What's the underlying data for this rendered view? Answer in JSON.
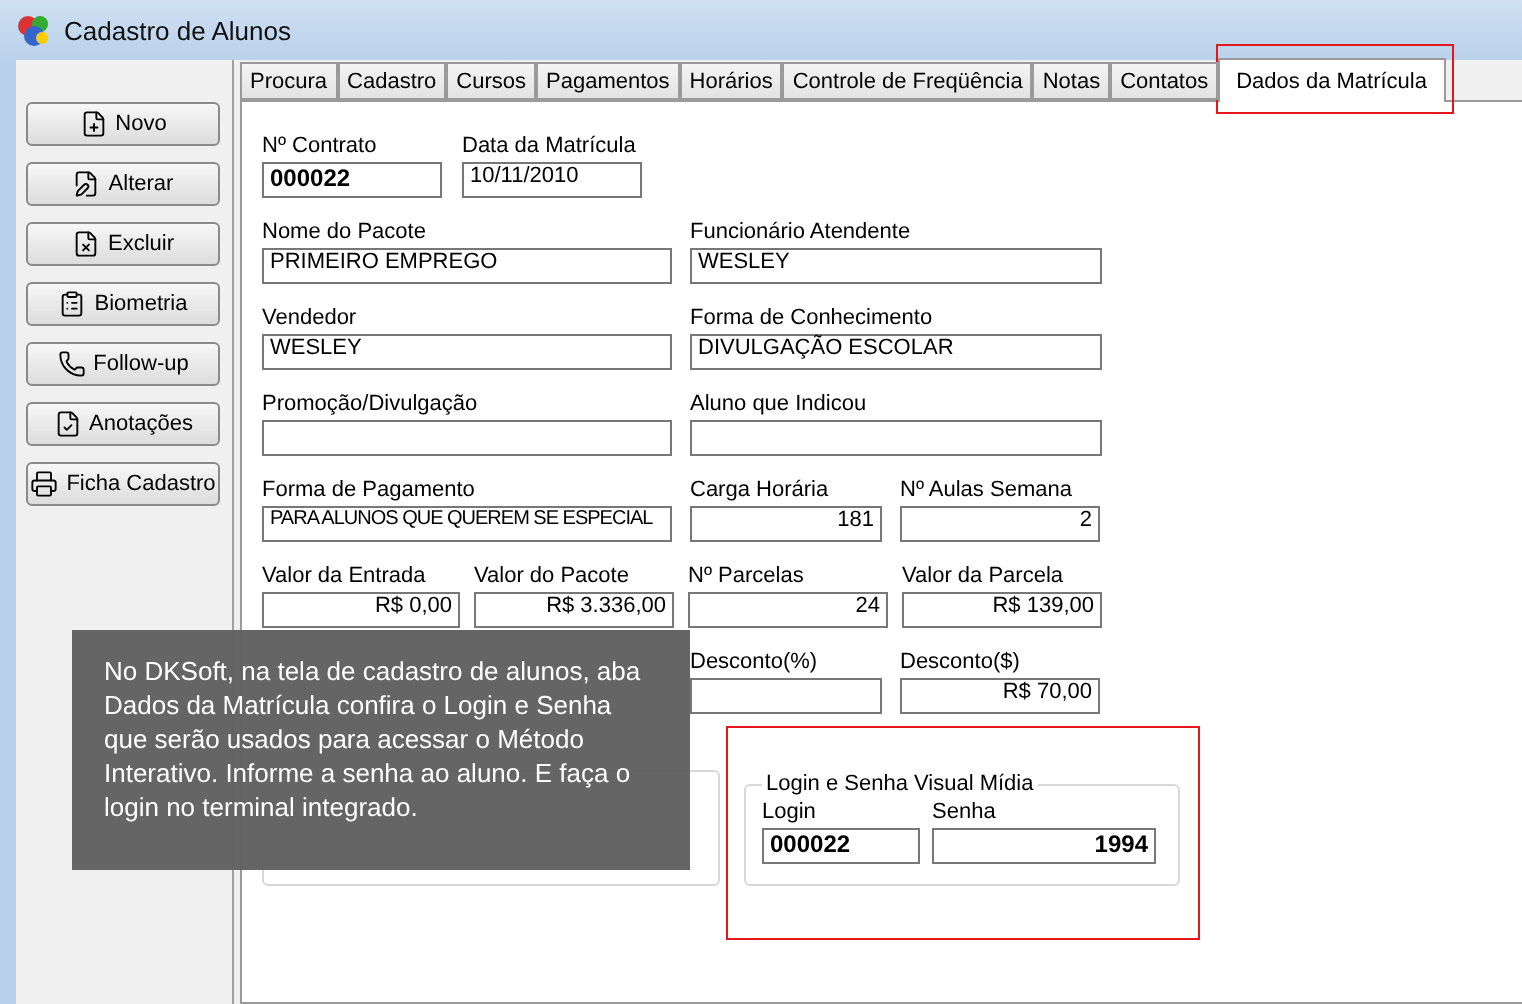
{
  "window": {
    "title": "Cadastro de Alunos"
  },
  "actions": [
    {
      "label": "Novo"
    },
    {
      "label": "Alterar"
    },
    {
      "label": "Excluir"
    },
    {
      "label": "Biometria"
    },
    {
      "label": "Follow-up"
    },
    {
      "label": "Anotações"
    },
    {
      "label": "Ficha Cadastro"
    }
  ],
  "tabs": [
    {
      "label": "Procura",
      "selected": false
    },
    {
      "label": "Cadastro",
      "selected": false
    },
    {
      "label": "Cursos",
      "selected": false
    },
    {
      "label": "Pagamentos",
      "selected": false
    },
    {
      "label": "Horários",
      "selected": false
    },
    {
      "label": "Controle de Freqüência",
      "selected": false
    },
    {
      "label": "Notas",
      "selected": false
    },
    {
      "label": "Contatos",
      "selected": false
    },
    {
      "label": "Dados da Matrícula",
      "selected": true
    }
  ],
  "form_rows": [
    {
      "kind": "short",
      "fields": [
        {
          "kind": "code",
          "label": "Nº Contrato",
          "value": "000022"
        },
        {
          "kind": "text",
          "label": "Data da Matrícula",
          "value": "10/11/2010"
        }
      ]
    },
    {
      "kind": "wide",
      "fields": [
        {
          "kind": "text",
          "label": "Nome do Pacote",
          "value": "PRIMEIRO EMPREGO"
        },
        {
          "kind": "text",
          "label": "Funcionário Atendente",
          "value": "WESLEY"
        }
      ]
    },
    {
      "kind": "wide",
      "fields": [
        {
          "kind": "text",
          "label": "Vendedor",
          "value": "WESLEY"
        },
        {
          "kind": "text",
          "label": "Forma de Conhecimento",
          "value": "DIVULGAÇÃO ESCOLAR"
        }
      ]
    },
    {
      "kind": "wide",
      "fields": [
        {
          "kind": "text",
          "label": "Promoção/Divulgação"
        },
        {
          "kind": "text",
          "label": "Aluno que Indicou"
        }
      ]
    },
    {
      "kind": "mixed",
      "fields": [
        {
          "kind": "long",
          "label": "Forma de Pagamento",
          "value": "PARA ALUNOS QUE QUEREM SE ESPECIAL"
        },
        {
          "kind": "number",
          "label": "Carga Horária",
          "value": "181"
        },
        {
          "kind": "number",
          "label": "Nº Aulas Semana",
          "value": "2"
        }
      ]
    },
    {
      "kind": "quarter",
      "fields": [
        {
          "kind": "number",
          "label": "Valor da Entrada",
          "value": "R$ 0,00"
        },
        {
          "kind": "number",
          "label": "Valor do Pacote",
          "value": "R$ 3.336,00"
        },
        {
          "kind": "number",
          "label": "Nº Parcelas",
          "value": "24"
        },
        {
          "kind": "number",
          "label": "Valor da Parcela",
          "value": "R$ 139,00"
        }
      ]
    },
    {
      "kind": "mixed",
      "fields": [
        {
          "kind": "covered"
        },
        {
          "kind": "number",
          "label": "Desconto(%)"
        },
        {
          "kind": "number",
          "label": "Desconto($)",
          "value": "R$ 70,00"
        }
      ]
    }
  ],
  "login_groups": [
    {
      "kind": "covered"
    },
    {
      "kind": "group",
      "title": "Login e Senha Visual Mídia",
      "fields": [
        {
          "kind": "code",
          "label": "Login",
          "value": "000022"
        },
        {
          "kind": "code_number",
          "label": "Senha",
          "value": "1994"
        }
      ]
    }
  ],
  "note": {
    "text": "No DKSoft, na tela de cadastro de alunos, aba Dados da Matrícula confira o Login e Senha que serão usados para acessar o Método Interativo. Informe a senha ao aluno. E faça o login no terminal integrado."
  }
}
